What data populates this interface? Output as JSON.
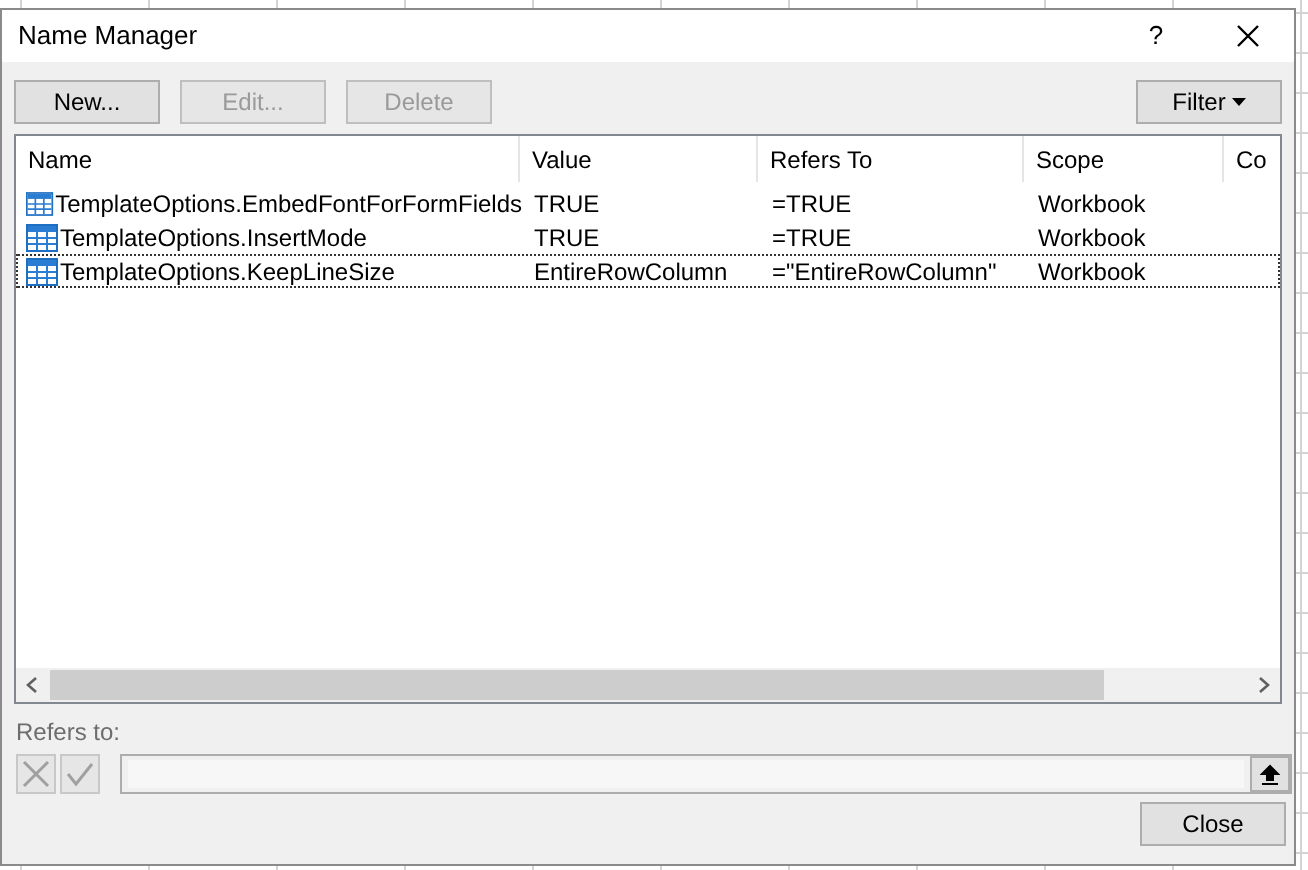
{
  "window": {
    "title": "Name Manager",
    "help": "?"
  },
  "buttons": [
    {
      "label": "New...",
      "disabled": false
    },
    {
      "label": "Edit...",
      "disabled": true
    },
    {
      "label": "Delete",
      "disabled": true
    }
  ],
  "filter_button": {
    "label": "Filter"
  },
  "table": {
    "columns": [
      "Name",
      "Value",
      "Refers To",
      "Scope",
      "Co"
    ],
    "rows": [
      {
        "cells": [
          "TemplateOptions.EmbedFontForFormFields",
          "TRUE",
          "=TRUE",
          "Workbook"
        ],
        "focused": false
      },
      {
        "cells": [
          "TemplateOptions.InsertMode",
          "TRUE",
          "=TRUE",
          "Workbook"
        ],
        "focused": false
      },
      {
        "cells": [
          "TemplateOptions.KeepLineSize",
          "EntireRowColumn",
          "=\"EntireRowColumn\"",
          "Workbook"
        ],
        "focused": true
      }
    ]
  },
  "refers_to": {
    "label": "Refers to:",
    "disabled": true
  },
  "close_button": {
    "label": "Close"
  }
}
